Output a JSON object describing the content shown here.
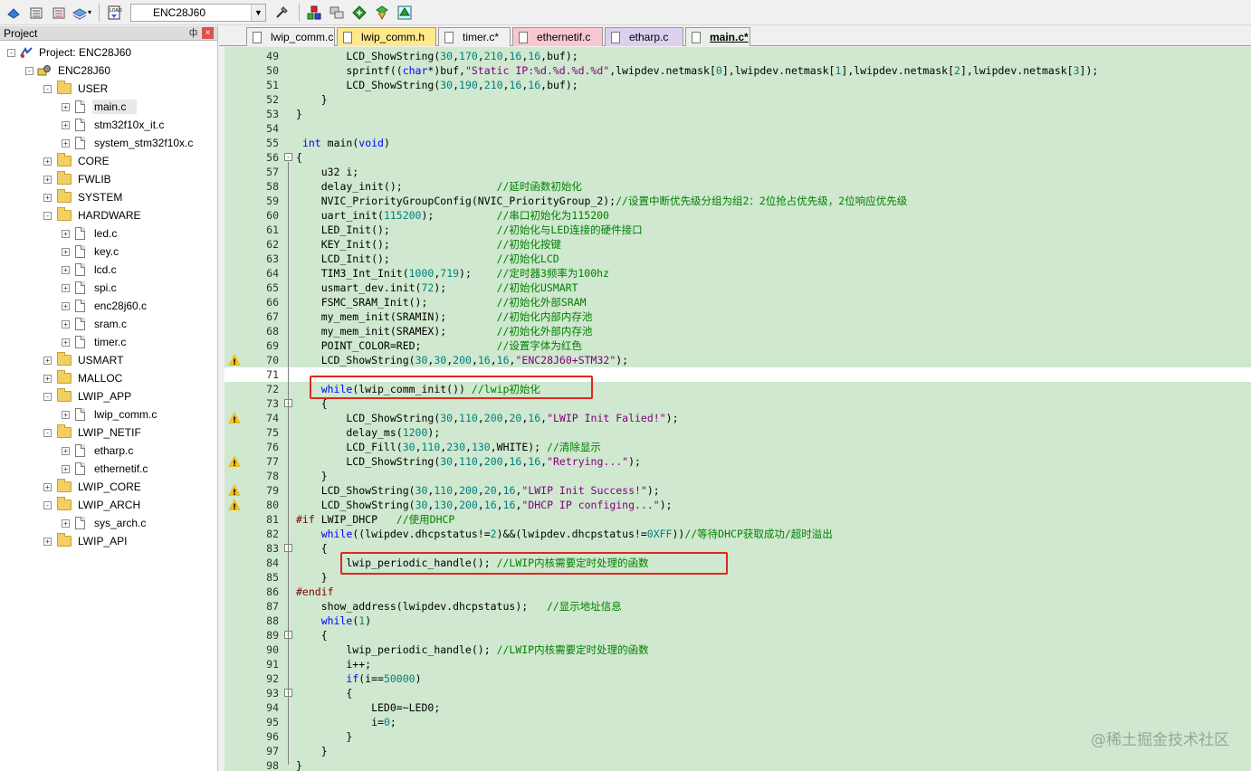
{
  "toolbar": {
    "target_name": "ENC28J60",
    "icons": [
      "translate-icon",
      "build-icon",
      "rebuild-all-icon",
      "batch-build-icon",
      "download-icon",
      "target-options-icon",
      "manage-components-icon",
      "select-packs-icon",
      "pack-installer-icon",
      "run-time-env-icon"
    ]
  },
  "project_panel": {
    "title": "Project",
    "pin_glyph": "ф",
    "close_glyph": "×",
    "tree": [
      {
        "label": "Project: ENC28J60",
        "level": 0,
        "type": "project",
        "expander": "-"
      },
      {
        "label": "ENC28J60",
        "level": 1,
        "type": "target",
        "expander": "-"
      },
      {
        "label": "USER",
        "level": 2,
        "type": "folder",
        "expander": "-"
      },
      {
        "label": "main.c",
        "level": 3,
        "type": "file",
        "expander": "+",
        "selected": true
      },
      {
        "label": "stm32f10x_it.c",
        "level": 3,
        "type": "file",
        "expander": "+"
      },
      {
        "label": "system_stm32f10x.c",
        "level": 3,
        "type": "file",
        "expander": "+"
      },
      {
        "label": "CORE",
        "level": 2,
        "type": "folder",
        "expander": "+"
      },
      {
        "label": "FWLIB",
        "level": 2,
        "type": "folder",
        "expander": "+"
      },
      {
        "label": "SYSTEM",
        "level": 2,
        "type": "folder",
        "expander": "+"
      },
      {
        "label": "HARDWARE",
        "level": 2,
        "type": "folder",
        "expander": "-"
      },
      {
        "label": "led.c",
        "level": 3,
        "type": "file",
        "expander": "+"
      },
      {
        "label": "key.c",
        "level": 3,
        "type": "file",
        "expander": "+"
      },
      {
        "label": "lcd.c",
        "level": 3,
        "type": "file",
        "expander": "+"
      },
      {
        "label": "spi.c",
        "level": 3,
        "type": "file",
        "expander": "+"
      },
      {
        "label": "enc28j60.c",
        "level": 3,
        "type": "file",
        "expander": "+"
      },
      {
        "label": "sram.c",
        "level": 3,
        "type": "file",
        "expander": "+"
      },
      {
        "label": "timer.c",
        "level": 3,
        "type": "file",
        "expander": "+"
      },
      {
        "label": "USMART",
        "level": 2,
        "type": "folder",
        "expander": "+"
      },
      {
        "label": "MALLOC",
        "level": 2,
        "type": "folder",
        "expander": "+"
      },
      {
        "label": "LWIP_APP",
        "level": 2,
        "type": "folder",
        "expander": "-"
      },
      {
        "label": "lwip_comm.c",
        "level": 3,
        "type": "file",
        "expander": "+"
      },
      {
        "label": "LWIP_NETIF",
        "level": 2,
        "type": "folder",
        "expander": "-"
      },
      {
        "label": "etharp.c",
        "level": 3,
        "type": "file",
        "expander": "+"
      },
      {
        "label": "ethernetif.c",
        "level": 3,
        "type": "file",
        "expander": "+"
      },
      {
        "label": "LWIP_CORE",
        "level": 2,
        "type": "folder",
        "expander": "+"
      },
      {
        "label": "LWIP_ARCH",
        "level": 2,
        "type": "folder",
        "expander": "-"
      },
      {
        "label": "sys_arch.c",
        "level": 3,
        "type": "file",
        "expander": "+"
      },
      {
        "label": "LWIP_API",
        "level": 2,
        "type": "folder",
        "expander": "+"
      }
    ]
  },
  "tabs": [
    {
      "label": "lwip_comm.c",
      "color": "#f0f0f0",
      "active": false
    },
    {
      "label": "lwip_comm.h",
      "color": "#ffe98a",
      "active": false
    },
    {
      "label": "timer.c*",
      "color": "#f0f0f0",
      "active": false
    },
    {
      "label": "ethernetif.c",
      "color": "#f7c8cf",
      "active": false
    },
    {
      "label": "etharp.c",
      "color": "#dcd0ee",
      "active": false
    },
    {
      "label": "main.c*",
      "color": "#e8f0e8",
      "active": true
    }
  ],
  "editor": {
    "current_line": 71,
    "lines": [
      {
        "n": "49",
        "code": "        LCD_ShowString(30,170,210,16,16,buf);"
      },
      {
        "n": "50",
        "code": "        sprintf((char*)buf,\"Static IP:%d.%d.%d.%d\",lwipdev.netmask[0],lwipdev.netmask[1],lwipdev.netmask[2],lwipdev.netmask[3]);"
      },
      {
        "n": "51",
        "code": "        LCD_ShowString(30,190,210,16,16,buf);"
      },
      {
        "n": "52",
        "code": "    }"
      },
      {
        "n": "53",
        "code": "}"
      },
      {
        "n": "54",
        "code": ""
      },
      {
        "n": "55",
        "code": " int main(void)"
      },
      {
        "n": "56",
        "code": "{"
      },
      {
        "n": "57",
        "code": "    u32 i;"
      },
      {
        "n": "58",
        "code": "    delay_init();               //延时函数初始化"
      },
      {
        "n": "59",
        "code": "    NVIC_PriorityGroupConfig(NVIC_PriorityGroup_2);//设置中断优先级分组为组2：2位抢占优先级，2位响应优先级"
      },
      {
        "n": "60",
        "code": "    uart_init(115200);          //串口初始化为115200"
      },
      {
        "n": "61",
        "code": "    LED_Init();                 //初始化与LED连接的硬件接口"
      },
      {
        "n": "62",
        "code": "    KEY_Init();                 //初始化按键"
      },
      {
        "n": "63",
        "code": "    LCD_Init();                 //初始化LCD"
      },
      {
        "n": "64",
        "code": "    TIM3_Int_Init(1000,719);    //定时器3频率为100hz"
      },
      {
        "n": "65",
        "code": "    usmart_dev.init(72);        //初始化USMART"
      },
      {
        "n": "66",
        "code": "    FSMC_SRAM_Init();           //初始化外部SRAM"
      },
      {
        "n": "67",
        "code": "    my_mem_init(SRAMIN);        //初始化内部内存池"
      },
      {
        "n": "68",
        "code": "    my_mem_init(SRAMEX);        //初始化外部内存池"
      },
      {
        "n": "69",
        "code": "    POINT_COLOR=RED;            //设置字体为红色"
      },
      {
        "n": "70",
        "code": "    LCD_ShowString(30,30,200,16,16,\"ENC28J60+STM32\");"
      },
      {
        "n": "71",
        "code": ""
      },
      {
        "n": "72",
        "code": "    while(lwip_comm_init()) //lwip初始化"
      },
      {
        "n": "73",
        "code": "    {"
      },
      {
        "n": "74",
        "code": "        LCD_ShowString(30,110,200,20,16,\"LWIP Init Falied!\");"
      },
      {
        "n": "75",
        "code": "        delay_ms(1200);"
      },
      {
        "n": "76",
        "code": "        LCD_Fill(30,110,230,130,WHITE); //清除显示"
      },
      {
        "n": "77",
        "code": "        LCD_ShowString(30,110,200,16,16,\"Retrying...\");"
      },
      {
        "n": "78",
        "code": "    }"
      },
      {
        "n": "79",
        "code": "    LCD_ShowString(30,110,200,20,16,\"LWIP Init Success!\");"
      },
      {
        "n": "80",
        "code": "    LCD_ShowString(30,130,200,16,16,\"DHCP IP configing...\");"
      },
      {
        "n": "81",
        "code": "#if LWIP_DHCP   //使用DHCP"
      },
      {
        "n": "82",
        "code": "    while((lwipdev.dhcpstatus!=2)&&(lwipdev.dhcpstatus!=0XFF))//等待DHCP获取成功/超时溢出"
      },
      {
        "n": "83",
        "code": "    {"
      },
      {
        "n": "84",
        "code": "        lwip_periodic_handle(); //LWIP内核需要定时处理的函数"
      },
      {
        "n": "85",
        "code": "    }"
      },
      {
        "n": "86",
        "code": "#endif"
      },
      {
        "n": "87",
        "code": "    show_address(lwipdev.dhcpstatus);   //显示地址信息"
      },
      {
        "n": "88",
        "code": "    while(1)"
      },
      {
        "n": "89",
        "code": "    {"
      },
      {
        "n": "90",
        "code": "        lwip_periodic_handle(); //LWIP内核需要定时处理的函数"
      },
      {
        "n": "91",
        "code": "        i++;"
      },
      {
        "n": "92",
        "code": "        if(i==50000)"
      },
      {
        "n": "93",
        "code": "        {"
      },
      {
        "n": "94",
        "code": "            LED0=~LED0;"
      },
      {
        "n": "95",
        "code": "            i=0;"
      },
      {
        "n": "96",
        "code": "        }"
      },
      {
        "n": "97",
        "code": "    }"
      },
      {
        "n": "98",
        "code": "}"
      }
    ],
    "warning_lines": [
      "70",
      "74",
      "77",
      "79",
      "80"
    ]
  },
  "watermark": "@稀土掘金技术社区",
  "colors": {
    "editor_bg": "#cfe8cf",
    "highlight_box": "#e0281e",
    "keyword": "#0000ff",
    "number": "#008080",
    "string": "#800080",
    "comment": "#008000"
  }
}
